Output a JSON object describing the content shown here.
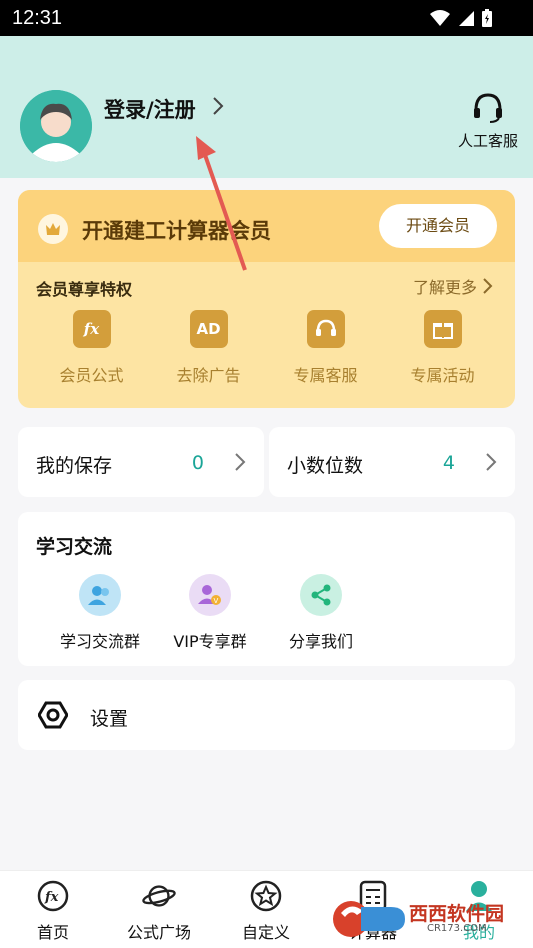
{
  "status_bar": {
    "time": "12:31"
  },
  "header": {
    "login_label": "登录/注册",
    "customer_service_label": "人工客服"
  },
  "vip": {
    "title": "开通建工计算器会员",
    "open_button": "开通会员",
    "privilege_label": "会员尊享特权",
    "more_label": "了解更多",
    "privileges": [
      {
        "label": "会员公式",
        "icon": "formula-icon"
      },
      {
        "label": "去除广告",
        "icon": "ad-icon"
      },
      {
        "label": "专属客服",
        "icon": "headset-icon"
      },
      {
        "label": "专属活动",
        "icon": "gift-icon"
      }
    ],
    "colors": {
      "top": "#fcd37c",
      "body": "#fde4a3",
      "icon": "#d39e3b"
    }
  },
  "stats": [
    {
      "label": "我的保存",
      "value": "0"
    },
    {
      "label": "小数位数",
      "value": "4"
    }
  ],
  "learn": {
    "title": "学习交流",
    "items": [
      {
        "label": "学习交流群",
        "icon": "group-icon"
      },
      {
        "label": "VIP专享群",
        "icon": "vip-group-icon"
      },
      {
        "label": "分享我们",
        "icon": "share-icon"
      }
    ]
  },
  "settings": {
    "label": "设置"
  },
  "bottom_nav": {
    "items": [
      {
        "label": "首页",
        "icon": "fx-icon"
      },
      {
        "label": "公式广场",
        "icon": "planet-icon"
      },
      {
        "label": "自定义",
        "icon": "star-icon"
      },
      {
        "label": "计算器",
        "icon": "calculator-icon"
      },
      {
        "label": "我的",
        "icon": "user-icon"
      }
    ]
  },
  "watermark": {
    "text": "西西软件园",
    "sub": "CR173.COM"
  },
  "accent_color": "#2ab09d"
}
